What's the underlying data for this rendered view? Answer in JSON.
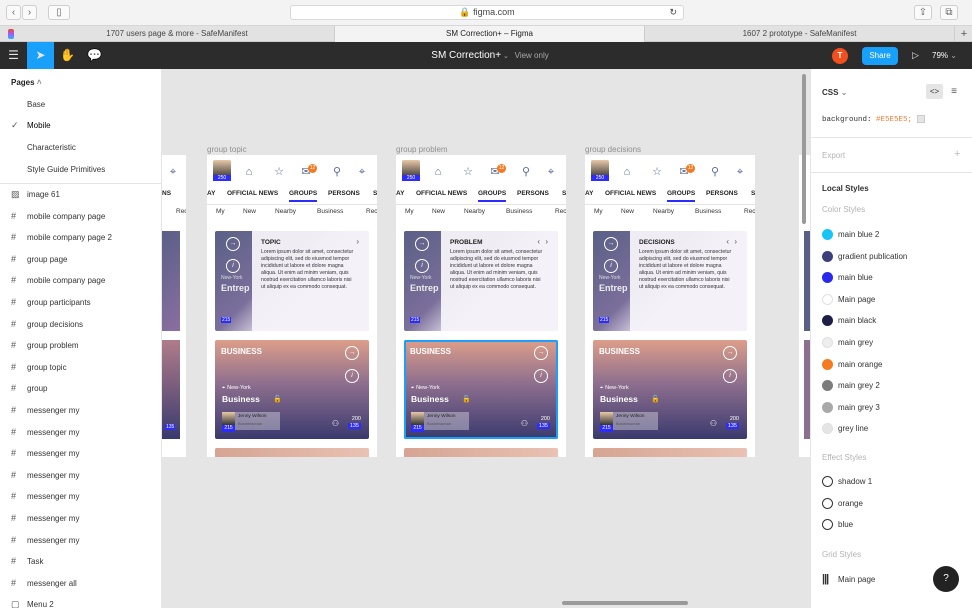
{
  "browser": {
    "url": "figma.com",
    "tabs": [
      {
        "label": "1707 users page & more - SafeManifest"
      },
      {
        "label": "SM Correction+ – Figma"
      },
      {
        "label": "1607 2 prototype - SafeManifest"
      }
    ]
  },
  "toolbar": {
    "file_name": "SM Correction+",
    "view_mode": "View only",
    "avatar_initial": "T",
    "share_label": "Share",
    "zoom": "79%"
  },
  "left_panel": {
    "pages_label": "Pages",
    "pages": [
      {
        "label": "Base",
        "selected": false
      },
      {
        "label": "Mobile",
        "selected": true
      },
      {
        "label": "Characteristic",
        "selected": false
      },
      {
        "label": "Style Guide Primitives",
        "selected": false
      }
    ],
    "layers": [
      {
        "label": "image 61",
        "icon": "image-icon"
      },
      {
        "label": "mobile company page",
        "icon": "frame-icon"
      },
      {
        "label": "mobile company page 2",
        "icon": "frame-icon"
      },
      {
        "label": "group page",
        "icon": "frame-icon"
      },
      {
        "label": "mobile company page",
        "icon": "frame-icon"
      },
      {
        "label": "group participants",
        "icon": "frame-icon"
      },
      {
        "label": "group decisions",
        "icon": "frame-icon"
      },
      {
        "label": "group problem",
        "icon": "frame-icon"
      },
      {
        "label": "group topic",
        "icon": "frame-icon"
      },
      {
        "label": "group",
        "icon": "frame-icon"
      },
      {
        "label": "messenger my",
        "icon": "frame-icon"
      },
      {
        "label": "messenger my",
        "icon": "frame-icon"
      },
      {
        "label": "messenger my",
        "icon": "frame-icon"
      },
      {
        "label": "messenger my",
        "icon": "frame-icon"
      },
      {
        "label": "messenger my",
        "icon": "frame-icon"
      },
      {
        "label": "messenger my",
        "icon": "frame-icon"
      },
      {
        "label": "messenger my",
        "icon": "frame-icon"
      },
      {
        "label": "Task",
        "icon": "frame-icon"
      },
      {
        "label": "messenger all",
        "icon": "frame-icon"
      },
      {
        "label": "Menu 2",
        "icon": "component-icon"
      }
    ]
  },
  "canvas": {
    "frames": [
      {
        "label": "group topic",
        "card_title": "TOPIC"
      },
      {
        "label": "group problem",
        "card_title": "PROBLEM"
      },
      {
        "label": "group decisions",
        "card_title": "DECISIONS"
      }
    ],
    "nav_badge": "250",
    "mail_badge": "12",
    "categories": [
      "AY",
      "OFFICIAL NEWS",
      "GROUPS",
      "PERSONS",
      "S"
    ],
    "subtabs": [
      "My",
      "New",
      "Nearby",
      "Business",
      "Rec"
    ],
    "partial_left_categories": "NS",
    "partial_left_subtab": "Rec",
    "card_body": "Lorem ipsum dolor sit amet, consectetur adipiscing elit, sed do eiusmod tempor incididunt ut labore et dolore magna aliqua. Ut enim ad minim veniam, quis nostrud exercitation ullamco laboris nisi ut aliquip ex ea commodo consequat.",
    "card_side_text": "Entrep",
    "card_side_sub": "New-York",
    "card_side_num": "215",
    "biz_tag": "BUSINESS",
    "biz_location": "New-York",
    "biz_title": "Business",
    "biz_user_name": "Jenny Wilson",
    "biz_user_role": "Businessman",
    "biz_count": "215",
    "biz_members": "200",
    "biz_members_badge": "135",
    "partial_left_badge": "135"
  },
  "right_panel": {
    "css_label": "CSS",
    "css_line_key": "background:",
    "css_line_value": "#E5E5E5;",
    "export_label": "Export",
    "local_styles_label": "Local Styles",
    "color_styles_label": "Color Styles",
    "colors": [
      {
        "name": "main blue 2",
        "hex": "#18c4f5"
      },
      {
        "name": "gradient publication",
        "hex": "#3b3f7c"
      },
      {
        "name": "main blue",
        "hex": "#2929ee"
      },
      {
        "name": "Main page",
        "hex": "#ffffff"
      },
      {
        "name": "main black",
        "hex": "#1c1f45"
      },
      {
        "name": "main grey",
        "hex": "#eeeeee"
      },
      {
        "name": "main orange",
        "hex": "#f47b20"
      },
      {
        "name": "main grey 2",
        "hex": "#7c7c7c"
      },
      {
        "name": "main grey 3",
        "hex": "#a8a8a8"
      },
      {
        "name": "grey line",
        "hex": "#e5e5e5"
      }
    ],
    "effect_styles_label": "Effect Styles",
    "effects": [
      {
        "name": "shadow 1"
      },
      {
        "name": "orange"
      },
      {
        "name": "blue"
      }
    ],
    "grid_styles_label": "Grid Styles",
    "grids": [
      {
        "name": "Main page"
      }
    ],
    "help_label": "?"
  }
}
